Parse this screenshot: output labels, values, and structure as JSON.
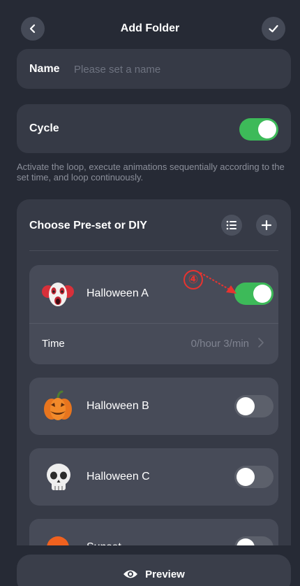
{
  "header": {
    "title": "Add Folder",
    "back_icon": "chevron-left-icon",
    "confirm_icon": "checkmark-icon"
  },
  "name_field": {
    "label": "Name",
    "placeholder": "Please set a name",
    "value": ""
  },
  "cycle": {
    "label": "Cycle",
    "enabled": true,
    "hint": "Activate the loop, execute animations sequentially according to the set time, and loop continuously."
  },
  "presets": {
    "title": "Choose Pre-set or DIY",
    "list_icon": "list-icon",
    "add_icon": "plus-icon",
    "items": [
      {
        "name": "Halloween A",
        "icon": "clown-icon",
        "enabled": true,
        "time_label": "Time",
        "time_value": "0/hour 3/min"
      },
      {
        "name": "Halloween B",
        "icon": "pumpkin-icon",
        "enabled": false
      },
      {
        "name": "Halloween C",
        "icon": "skull-icon",
        "enabled": false
      },
      {
        "name": "Sunset",
        "icon": "sun-icon",
        "enabled": false
      }
    ]
  },
  "annotation": {
    "label": "④",
    "color": "#e8332f"
  },
  "footer": {
    "preview_label": "Preview",
    "preview_icon": "eye-icon"
  },
  "colors": {
    "background": "#262a35",
    "card": "#363a46",
    "toggle_on": "#3dba59",
    "toggle_off": "#5c606b"
  }
}
